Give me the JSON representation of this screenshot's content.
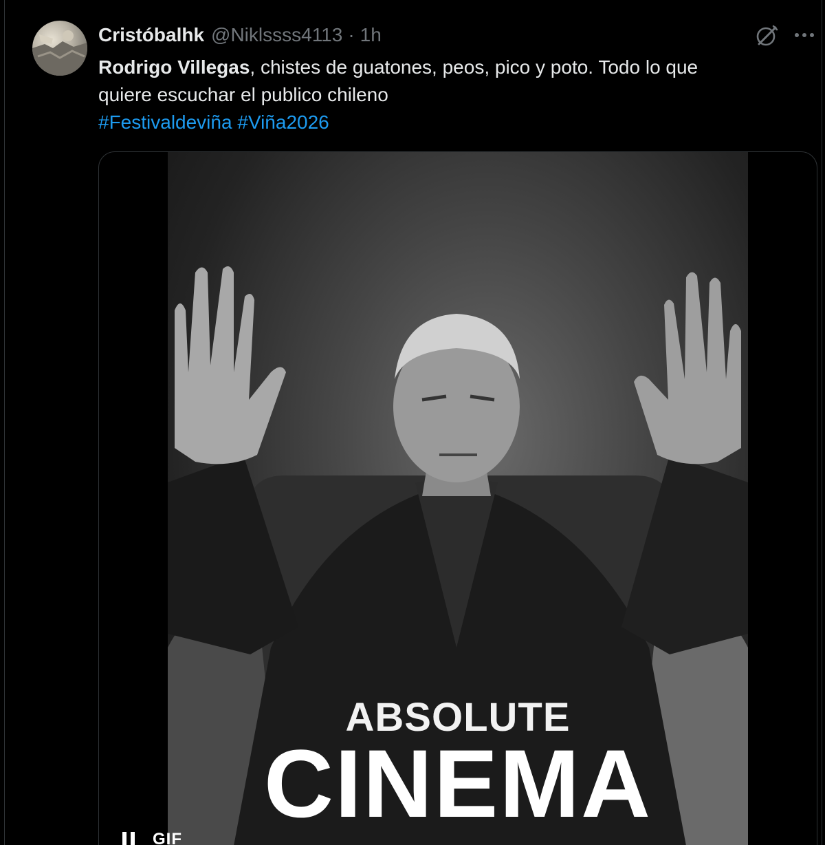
{
  "tweet": {
    "display_name": "Cristóbalhk",
    "handle": "@Niklssss4113",
    "separator": "·",
    "time": "1h",
    "text_bold": "Rodrigo Villegas",
    "text_line1_rest": ", chistes de guatones, peos, pico y poto. Todo lo que",
    "text_line2": "quiere escuchar el publico chileno",
    "hashtags": [
      "#Festivaldeviña",
      "#Viña2026"
    ]
  },
  "media": {
    "caption_top": "ABSOLUTE",
    "caption_bottom": "CINEMA",
    "badge": "GIF"
  },
  "icons": {
    "grok": "grok-icon",
    "more": "more-icon",
    "pause": "pause-icon"
  },
  "colors": {
    "background": "#000000",
    "text": "#e7e9ea",
    "muted": "#71767b",
    "link": "#1d9bf0",
    "border": "#2f3336"
  }
}
